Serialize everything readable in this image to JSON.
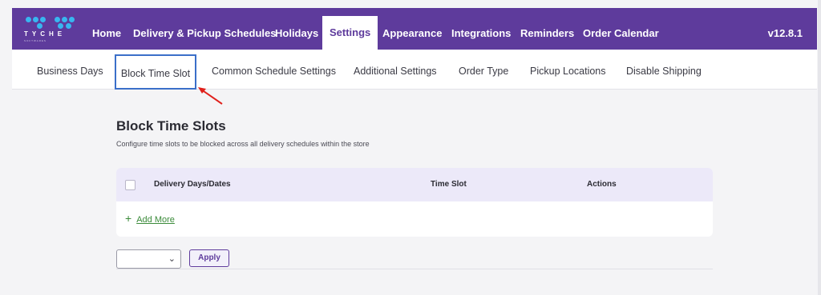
{
  "logo": {
    "word": "TYCHE",
    "sub": "SOFTWARES"
  },
  "nav": {
    "items": [
      {
        "label": "Home"
      },
      {
        "label": "Delivery & Pickup Schedules"
      },
      {
        "label": "Holidays"
      },
      {
        "label": "Settings",
        "active": true
      },
      {
        "label": "Appearance"
      },
      {
        "label": "Integrations"
      },
      {
        "label": "Reminders"
      },
      {
        "label": "Order Calendar"
      }
    ],
    "version": "v12.8.1"
  },
  "subtabs": [
    {
      "label": "Business Days"
    },
    {
      "label": "Block Time Slot",
      "active": true
    },
    {
      "label": "Common Schedule Settings"
    },
    {
      "label": "Additional Settings"
    },
    {
      "label": "Order Type"
    },
    {
      "label": "Pickup Locations"
    },
    {
      "label": "Disable Shipping"
    }
  ],
  "section": {
    "title": "Block Time Slots",
    "description": "Configure time slots to be blocked across all delivery schedules within the store"
  },
  "table": {
    "columns": [
      "Delivery Days/Dates",
      "Time Slot",
      "Actions"
    ],
    "add_more": "Add More"
  },
  "bulk": {
    "select_value": "",
    "apply_label": "Apply"
  },
  "colors": {
    "brand": "#5e3b9c",
    "accent": "#3b6fc9",
    "link": "#3b8b3a",
    "arrow": "#e0201b"
  }
}
